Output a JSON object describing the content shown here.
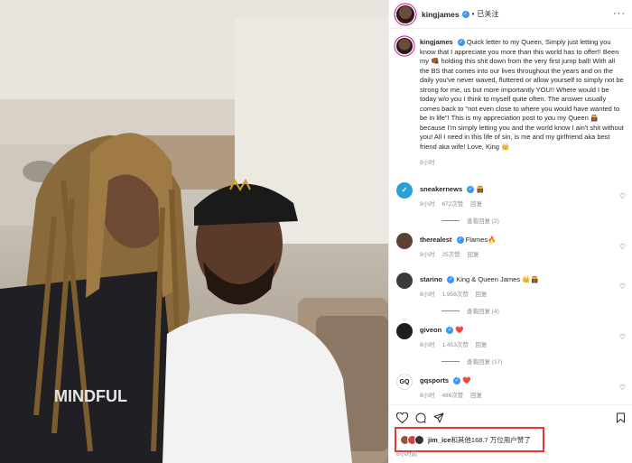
{
  "post": {
    "username": "kingjames",
    "follow_status": "已关注",
    "more_icon": "more-horizontal-icon",
    "image_alt": "Photo of two people smiling on a private jet"
  },
  "caption": {
    "username": "kingjames",
    "text": "Quick letter to my Queen, Simply just letting you know that I appreciate you more than this world has to offer!! Been my 👊🏾 holding this shit down from the very first jump ball! With all the BS that comes into our lives throughout the years and on the daily you've never waved, fluttered or allow yourself to simply not be strong for me, us but more importantly YOU!! Where would I be today w/o you I think to myself quite often. The answer usually comes back to \"not even close to where you would have wanted to be in life\"! This is my appreciation post to you my Queen 👸🏾 because I'm simply letting you and the world know I ain't shit without you! All I need in this life of sin, is me and my girlfriend aka best friend aka wife! Love, King 👑",
    "time": "8小时"
  },
  "comments": [
    {
      "username": "sneakernews",
      "text": "👸🏾",
      "time": "8小时",
      "likes": "672次赞",
      "reply_label": "回复",
      "view_replies": "查看回复 (2)",
      "avatar_color": "#2a9fd6"
    },
    {
      "username": "therealest",
      "text": "Flames🔥",
      "time": "8小时",
      "likes": "25次赞",
      "reply_label": "回复",
      "view_replies": "",
      "avatar_color": "#5c4033"
    },
    {
      "username": "starino",
      "text": "King & Queen James 👑👸🏾",
      "time": "8小时",
      "likes": "1,958次赞",
      "reply_label": "回复",
      "view_replies": "查看回复 (4)",
      "avatar_color": "#3b3b3b"
    },
    {
      "username": "giveon",
      "text": "❤️",
      "time": "8小时",
      "likes": "1,453次赞",
      "reply_label": "回复",
      "view_replies": "查看回复 (17)",
      "avatar_color": "#1f1f1f"
    },
    {
      "username": "gqsports",
      "text": "❤️",
      "time": "8小时",
      "likes": "486次赞",
      "reply_label": "回复",
      "view_replies": "",
      "avatar_color": "#ffffff"
    }
  ],
  "likes_summary": {
    "user": "jim_ice",
    "text": "和其他168.7 万位用户赞了",
    "highlight_color": "#e53935"
  },
  "post_time": "8小时前",
  "icons": [
    "heart-icon",
    "comment-icon",
    "share-icon",
    "bookmark-icon"
  ]
}
